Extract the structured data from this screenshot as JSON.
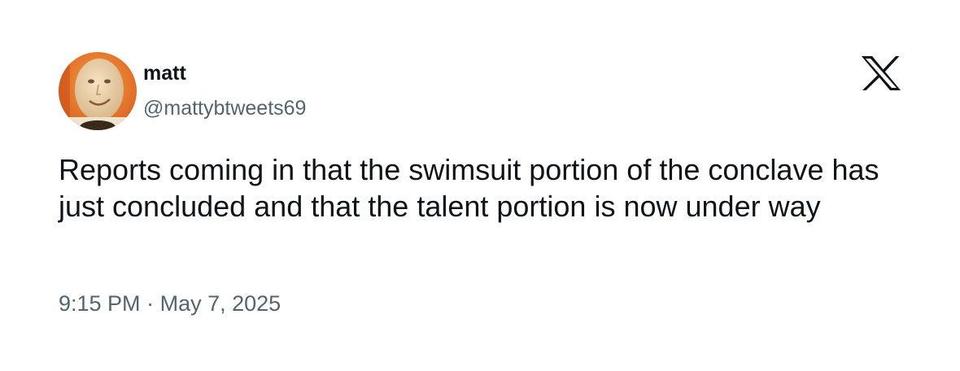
{
  "user": {
    "display_name": "matt",
    "handle": "@mattybtweets69"
  },
  "brand": {
    "logo_icon": "x-logo-icon"
  },
  "tweet": {
    "text": "Reports coming in that the swimsuit portion of the conclave has just concluded and that the talent portion is now under way",
    "time": "9:15 PM",
    "separator": "·",
    "date": "May 7, 2025"
  },
  "colors": {
    "text_primary": "#0f1419",
    "text_secondary": "#536471",
    "background": "#ffffff",
    "avatar_background": "#e8762c"
  }
}
